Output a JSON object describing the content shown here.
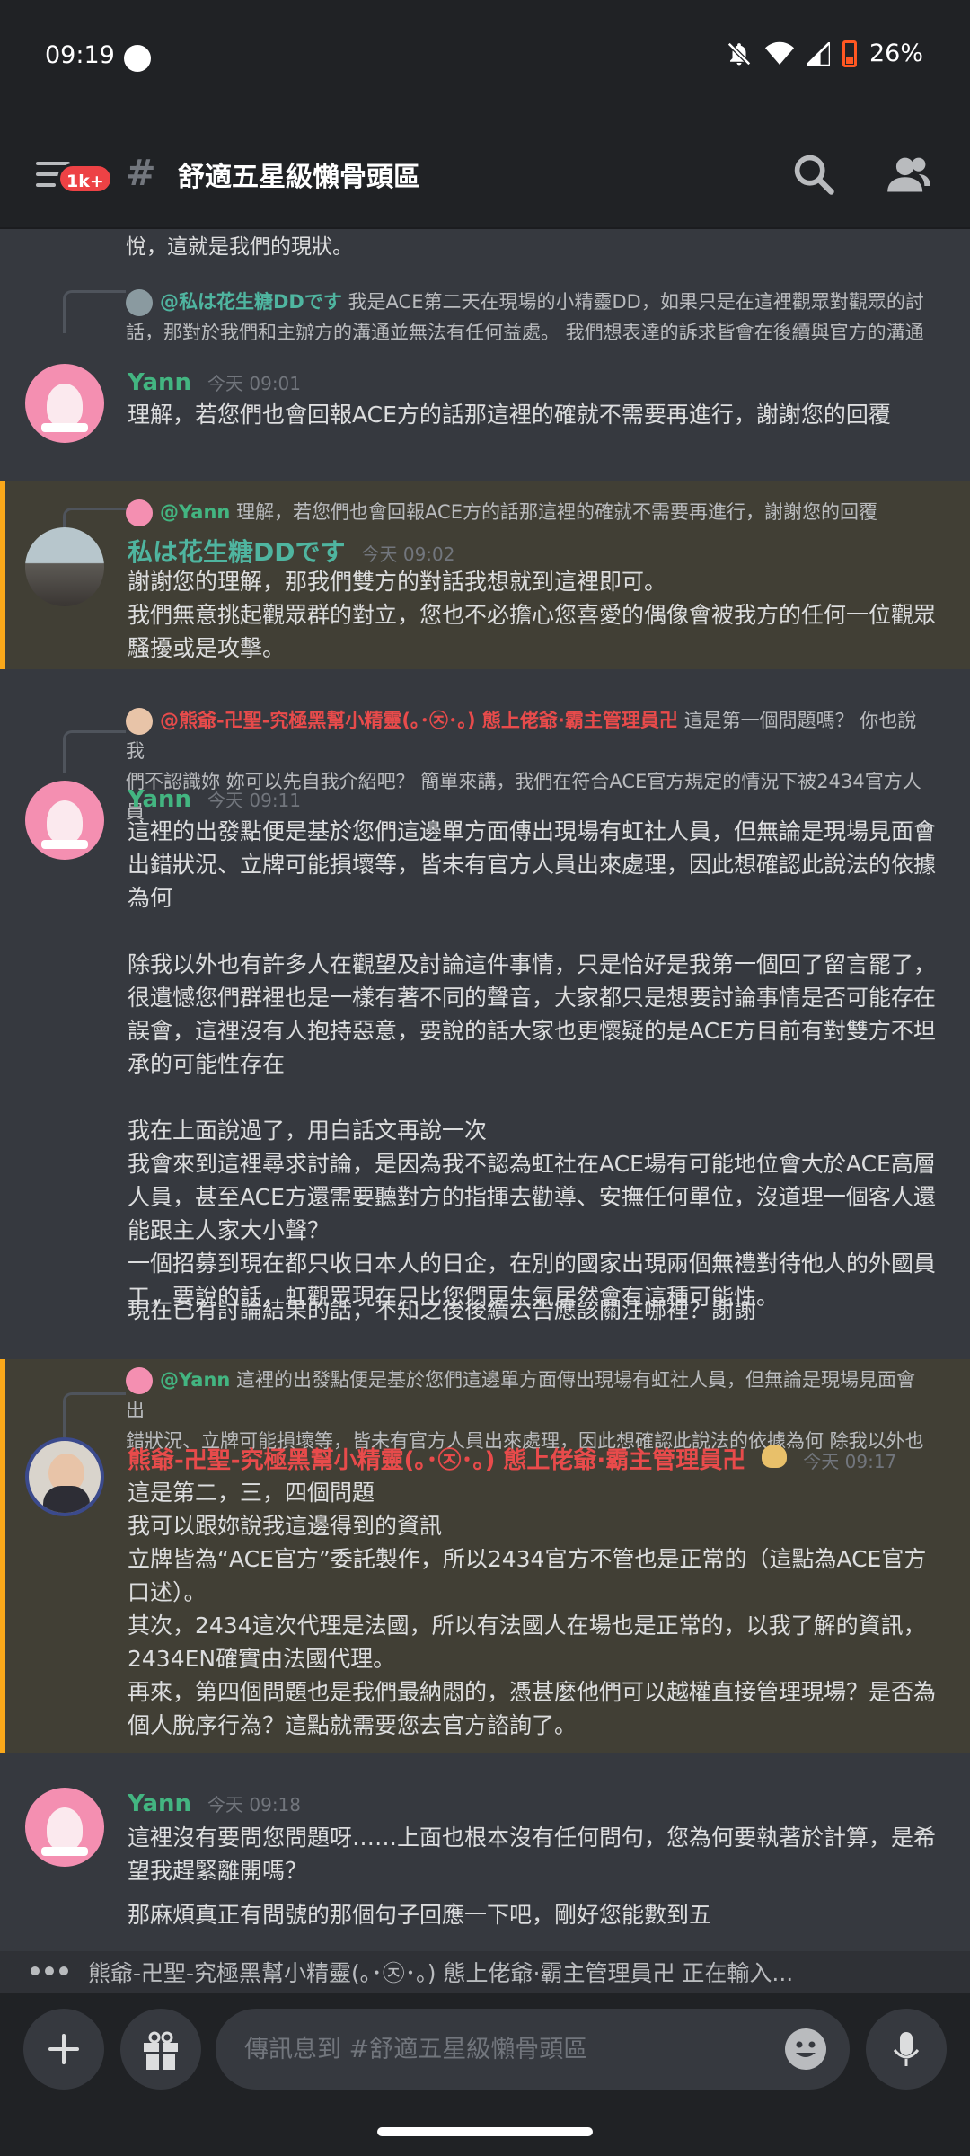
{
  "status": {
    "time": "09:19",
    "battery": "26%"
  },
  "header": {
    "badge": "1k+",
    "channel_name": "舒適五星級懶骨頭區"
  },
  "chat": {
    "top_fragment": "悅，這就是我們的現狀。",
    "messages": [
      {
        "reply_author": "@私は花生糖DDです",
        "reply_text_1": "我是ACE第二天在現場的小精靈DD，如果只是在這裡觀眾對觀眾的討",
        "reply_text_2": "話，那對於我們和主辦方的溝通並無法有任何益處。 我們想表達的訴求皆會在後續與官方的溝通",
        "author": "Yann",
        "time": "今天 09:01",
        "text": "理解，若您們也會回報ACE方的話那這裡的確就不需要再進行，謝謝您的回覆"
      },
      {
        "reply_author": "@Yann",
        "reply_text_1": "理解，若您們也會回報ACE方的話那這裡的確就不需要再進行，謝謝您的回覆",
        "author": "私は花生糖DDです",
        "time": "今天 09:02",
        "text": "謝謝您的理解，那我們雙方的對話我想就到這裡即可。\n我們無意挑起觀眾群的對立，您也不必擔心您喜愛的偶像會被我方的任何一位觀眾騷擾或是攻擊。"
      },
      {
        "reply_author": "@熊爺-卍聖-究極黑幫小精靈(｡･㉨･｡) 態上佬爺·霸主管理員卍",
        "reply_text_1": "這是第一個問題嗎？ 你也說我",
        "reply_text_2": "們不認識妳 妳可以先自我介紹吧？ 簡單來講，我們在符合ACE官方規定的情況下被2434官方人員",
        "author": "Yann",
        "time": "今天 09:11",
        "text": "這裡的出發點便是基於您們這邊單方面傳出現場有虹社人員，但無論是現場見面會出錯狀況、立牌可能損壞等，皆未有官方人員出來處理，因此想確認此說法的依據為何\n\n除我以外也有許多人在觀望及討論這件事情，只是恰好是我第一個回了留言罷了，很遺憾您們群裡也是一樣有著不同的聲音，大家都只是想要討論事情是否可能存在誤會，這裡沒有人抱持惡意，要說的話大家也更懷疑的是ACE方目前有對雙方不坦承的可能性存在\n\n我在上面說過了，用白話文再說一次\n我會來到這裡尋求討論，是因為我不認為虹社在ACE場有可能地位會大於ACE高層人員，甚至ACE方還需要聽對方的指揮去勸導、安撫任何單位，沒道理一個客人還能跟主人家大小聲？\n一個招募到現在都只收日本人的日企，在別的國家出現兩個無禮對待他人的外國員工，要說的話，虹觀眾現在只比您們更生氣居然會有這種可能性。",
        "text_extra": "現在已有討論結果的話，不知之後後續公告應該關注哪裡？謝謝"
      },
      {
        "reply_author": "@Yann",
        "reply_text_1": "這裡的出發點便是基於您們這邊單方面傳出現場有虹社人員，但無論是現場見面會出",
        "reply_text_2": "錯狀況、立牌可能損壞等，皆未有官方人員出來處理，因此想確認此說法的依據為何  除我以外也",
        "author": "熊爺-卍聖-究極黑幫小精靈(｡･㉨･｡) 態上佬爺·霸主管理員卍",
        "time": "今天 09:17",
        "text": "這是第二，三，四個問題\n我可以跟妳說我這邊得到的資訊\n立牌皆為“ACE官方”委託製作，所以2434官方不管也是正常的（這點為ACE官方口述）。\n其次，2434這次代理是法國，所以有法國人在場也是正常的，以我了解的資訊，2434EN確實由法國代理。\n再來，第四個問題也是我們最納悶的，憑甚麼他們可以越權直接管理現場？是否為個人脫序行為？這點就需要您去官方諮詢了。"
      },
      {
        "author": "Yann",
        "time": "今天 09:18",
        "text": "這裡沒有要問您問題呀……上面也根本沒有任何問句，您為何要執著於計算，是希望我趕緊離開嗎？",
        "text_extra": "那麻煩真正有問號的那個句子回應一下吧，剛好您能數到五"
      }
    ]
  },
  "typing": {
    "text": "熊爺-卍聖-究極黑幫小精靈(｡･㉨･｡) 態上佬爺·霸主管理員卍 正在輸入..."
  },
  "composer": {
    "placeholder": "傳訊息到 #舒適五星級懶骨頭區"
  },
  "colors": {
    "yann": "#43b581",
    "hana": "#4fb5a0",
    "bear": "#e84b4b",
    "mention": "#faa81a"
  }
}
